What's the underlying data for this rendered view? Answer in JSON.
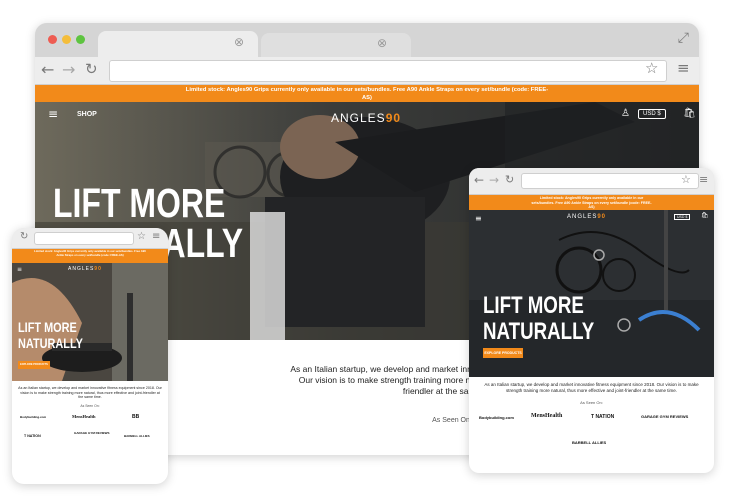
{
  "desktop": {
    "promo": "Limited stock: Angles90 Grips currently only available in our sets/bundles. Free A90 Ankle Straps on every set/bundle (code: FREE-AS)",
    "menu_label": "SHOP",
    "logo_main": "ANGLES",
    "logo_accent": "90",
    "currency": "USD $",
    "hero_line1": "LIFT MORE",
    "hero_line2": "NATURALLY",
    "blurb_line1": "As an Italian startup, we develop and market innovative fitness equipment since 2018.",
    "blurb_line2": "Our vision is to make strength training more natural, thus more effective and joint-",
    "blurb_line3": "friendler at the same time.",
    "as_seen_on": "As Seen On:"
  },
  "tablet": {
    "promo": "Limited stock: Angles90 Grips currently only available in our sets/bundles. Free A90 Ankle Straps on every set/bundle (code: FREE-AS)",
    "logo_main": "ANGLES",
    "logo_accent": "90",
    "currency": "USD $",
    "hero_line1": "LIFT MORE",
    "hero_line2": "NATURALLY",
    "cta": "EXPLORE PRODUCTS",
    "blurb": "As an Italian startup, we develop and market innovative fitness equipment since 2018. Our vision is to make strength training more natural, thus more effective and joint-friendler at the same time.",
    "as_seen_on": "As Seen On:",
    "brands": [
      "Bodybuilding.com",
      "MensHealth",
      "T NATION",
      "GARAGE GYM REVIEWS",
      "BARBELL ALLIES"
    ]
  },
  "phone": {
    "promo": "Limited stock: Angles90 Grips currently only available in our sets/bundles. Free A90 Ankle Straps on every set/bundle (code: FREE-AS)",
    "logo_main": "ANGLES",
    "logo_accent": "90",
    "hero_line1": "LIFT MORE",
    "hero_line2": "NATURALLY",
    "cta": "EXPLORE PRODUCTS",
    "blurb": "As an Italian startup, we develop and market innovative fitness equipment since 2018. Our vision is to make strength training more natural, thus more effective and joint-friendler at the same time.",
    "as_seen_on": "As Seen On:",
    "brands": [
      "Bodybuilding.com",
      "MensHealth",
      "BB",
      "T NATION",
      "GARAGE GYM REVIEWS",
      "BARBELL ALLIES"
    ]
  },
  "colors": {
    "accent": "#f28a1a",
    "hero_dark": "#2a2d30"
  }
}
